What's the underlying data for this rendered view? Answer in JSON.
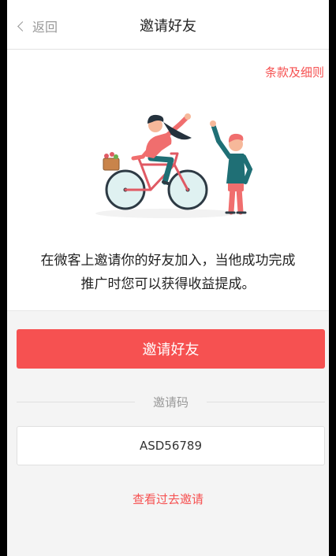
{
  "navbar": {
    "back_label": "返回",
    "title": "邀请好友"
  },
  "hero": {
    "terms_link": "条款及细则",
    "description_line1": "在微客上邀请你的好友加入，当他成功完成",
    "description_line2": "推广时您可以获得收益提成。",
    "illustration": "bicycle-high-five-illustration"
  },
  "actions": {
    "invite_button": "邀请好友",
    "code_label": "邀请码",
    "code_value": "ASD56789",
    "history_link": "查看过去邀请"
  },
  "colors": {
    "accent": "#f65151",
    "background": "#f4f4f4",
    "muted_text": "#999999"
  }
}
